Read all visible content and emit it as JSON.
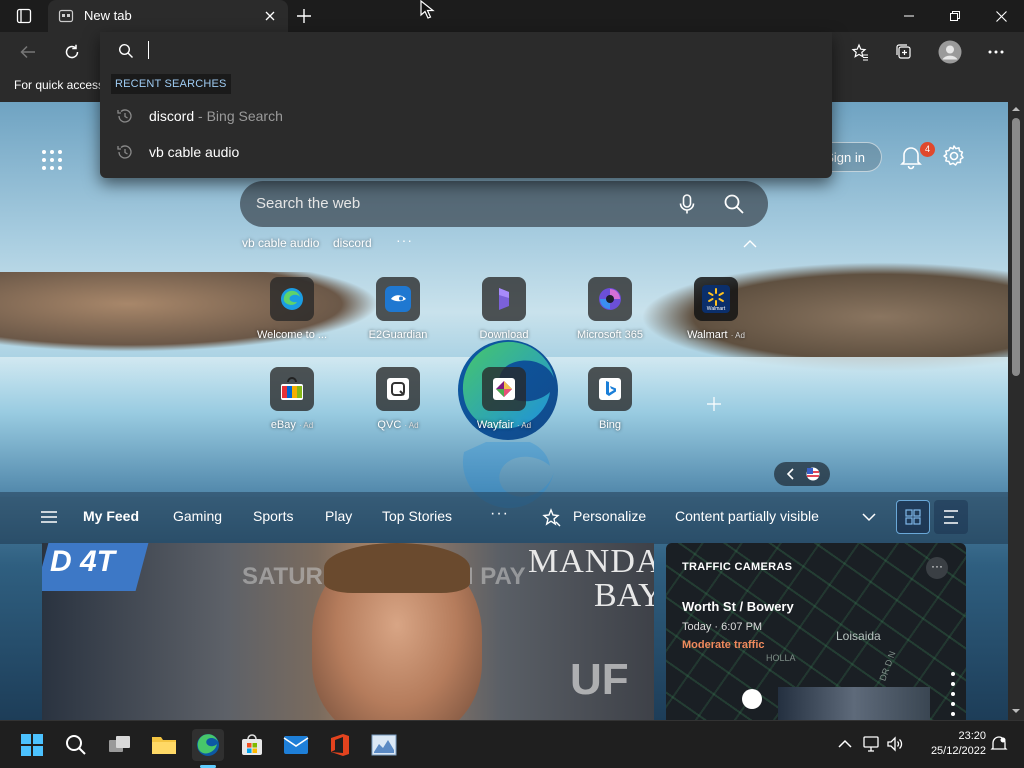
{
  "browser": {
    "tab_title": "New tab",
    "favorites_bar_text": "For quick access",
    "address_value": ""
  },
  "dropdown": {
    "section_header": "RECENT SEARCHES",
    "suggestions": [
      {
        "query": "discord",
        "source": " - Bing Search"
      },
      {
        "query": "vb cable audio",
        "source": ""
      }
    ]
  },
  "newtab": {
    "signin_label": "Sign in",
    "notification_count": "4",
    "search_placeholder": "Search the web",
    "recent_chips": [
      "vb cable audio",
      "discord"
    ],
    "more_label": "···",
    "tiles": [
      {
        "label": "Welcome to ...",
        "ad": "",
        "icon": "edge-icon"
      },
      {
        "label": "E2Guardian",
        "ad": "",
        "icon": "e2guardian-icon"
      },
      {
        "label": "Download",
        "ad": "",
        "icon": "download-icon"
      },
      {
        "label": "Microsoft 365",
        "ad": "",
        "icon": "microsoft365-icon"
      },
      {
        "label": "Walmart",
        "ad": "· Ad",
        "icon": "walmart-icon"
      },
      {
        "label": "eBay",
        "ad": "· Ad",
        "icon": "ebay-icon"
      },
      {
        "label": "QVC",
        "ad": "· Ad",
        "icon": "qvc-icon"
      },
      {
        "label": "Wayfair",
        "ad": "· Ad",
        "icon": "wayfair-icon"
      },
      {
        "label": "Bing",
        "ad": "",
        "icon": "bing-icon"
      }
    ],
    "walmart_text": "Walmart",
    "feed": {
      "items": [
        "My Feed",
        "Gaming",
        "Sports",
        "Play",
        "Top Stories"
      ],
      "more": "···",
      "personalize": "Personalize",
      "content_visibility": "Content partially visible"
    },
    "hero": {
      "sign_text_1": "MANDA",
      "sign_text_2": "BAY",
      "blue_text": "D 4T",
      "banner_text": "SATURDAY LIVE ON PAY",
      "ufc_text": "UF"
    },
    "traffic": {
      "header": "TRAFFIC CAMERAS",
      "location": "Worth St / Bowery",
      "time": "Today · 6:07 PM",
      "status": "Moderate traffic",
      "area": "Loisaida",
      "street1": "HOLLA",
      "street2": "DR D N",
      "more": "···"
    }
  },
  "taskbar": {
    "time": "23:20",
    "date": "25/12/2022"
  },
  "colors": {
    "accent": "#60cdff",
    "traffic_status": "#f08a5d",
    "badge": "#e0482c",
    "recent_header_text": "#9ecbf2"
  }
}
